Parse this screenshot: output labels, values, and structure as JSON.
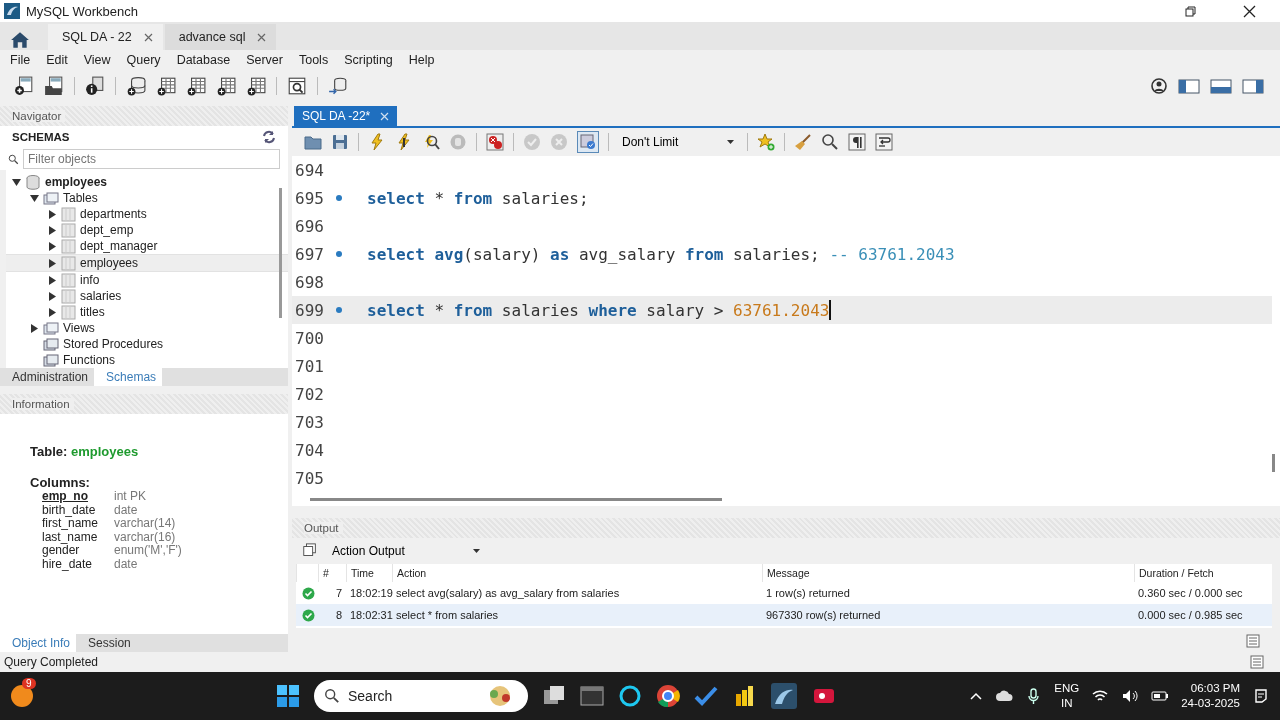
{
  "window": {
    "title": "MySQL Workbench"
  },
  "connection_tabs": [
    {
      "label": "SQL DA - 22",
      "selected": true
    },
    {
      "label": "advance sql",
      "selected": false
    }
  ],
  "menu": [
    "File",
    "Edit",
    "View",
    "Query",
    "Database",
    "Server",
    "Tools",
    "Scripting",
    "Help"
  ],
  "navigator": {
    "header": "Navigator",
    "schemas_title": "SCHEMAS",
    "filter_placeholder": "Filter objects",
    "tree": [
      {
        "label": "employees",
        "kind": "schema",
        "expanded": true,
        "selected": false,
        "children": [
          {
            "label": "Tables",
            "kind": "folder",
            "expanded": true,
            "selected": false,
            "children": [
              {
                "label": "departments",
                "kind": "table",
                "expanded": false,
                "selected": false
              },
              {
                "label": "dept_emp",
                "kind": "table",
                "expanded": false,
                "selected": false
              },
              {
                "label": "dept_manager",
                "kind": "table",
                "expanded": false,
                "selected": false
              },
              {
                "label": "employees",
                "kind": "table",
                "expanded": false,
                "selected": true
              },
              {
                "label": "info",
                "kind": "table",
                "expanded": false,
                "selected": false
              },
              {
                "label": "salaries",
                "kind": "table",
                "expanded": false,
                "selected": false
              },
              {
                "label": "titles",
                "kind": "table",
                "expanded": false,
                "selected": false
              }
            ]
          },
          {
            "label": "Views",
            "kind": "folder",
            "expanded": false,
            "selected": false
          },
          {
            "label": "Stored Procedures",
            "kind": "group",
            "selected": false
          },
          {
            "label": "Functions",
            "kind": "group",
            "selected": false
          }
        ]
      }
    ],
    "tabs": [
      {
        "label": "Administration",
        "selected": false
      },
      {
        "label": "Schemas",
        "selected": true
      }
    ]
  },
  "information": {
    "header": "Information",
    "table_label": "Table:",
    "table_name": "employees",
    "columns_label": "Columns:",
    "columns": [
      {
        "name": "emp_no",
        "type": "int PK",
        "primary": true
      },
      {
        "name": "birth_date",
        "type": "date",
        "primary": false
      },
      {
        "name": "first_name",
        "type": "varchar(14)",
        "primary": false
      },
      {
        "name": "last_name",
        "type": "varchar(16)",
        "primary": false
      },
      {
        "name": "gender",
        "type": "enum('M','F')",
        "primary": false
      },
      {
        "name": "hire_date",
        "type": "date",
        "primary": false
      }
    ],
    "tabs": [
      {
        "label": "Object Info",
        "selected": true
      },
      {
        "label": "Session",
        "selected": false
      }
    ]
  },
  "editor": {
    "tab": "SQL DA -22*",
    "limit": "Don't Limit",
    "autocommit": true,
    "lines": [
      {
        "number": "694",
        "statement": false,
        "current": false
      },
      {
        "number": "695",
        "statement": true,
        "current": false,
        "tokens": [
          {
            "kind": "keyword",
            "text": "select"
          },
          {
            "kind": "plain",
            "text": " * "
          },
          {
            "kind": "keyword",
            "text": "from"
          },
          {
            "kind": "plain",
            "text": " salaries;"
          }
        ]
      },
      {
        "number": "696",
        "statement": false,
        "current": false
      },
      {
        "number": "697",
        "statement": true,
        "current": false,
        "tokens": [
          {
            "kind": "keyword",
            "text": "select avg"
          },
          {
            "kind": "plain",
            "text": "(salary) "
          },
          {
            "kind": "keyword",
            "text": "as"
          },
          {
            "kind": "plain",
            "text": " avg_salary "
          },
          {
            "kind": "keyword",
            "text": "from"
          },
          {
            "kind": "plain",
            "text": " salaries; "
          },
          {
            "kind": "comment",
            "text": "-- 63761.2043"
          }
        ]
      },
      {
        "number": "698",
        "statement": false,
        "current": false
      },
      {
        "number": "699",
        "statement": true,
        "current": true,
        "tokens": [
          {
            "kind": "keyword",
            "text": "select"
          },
          {
            "kind": "plain",
            "text": " * "
          },
          {
            "kind": "keyword",
            "text": "from"
          },
          {
            "kind": "plain",
            "text": " salaries "
          },
          {
            "kind": "keyword",
            "text": "where"
          },
          {
            "kind": "plain",
            "text": " salary > "
          },
          {
            "kind": "number",
            "text": "63761.2043"
          }
        ]
      },
      {
        "number": "700",
        "statement": false,
        "current": false
      },
      {
        "number": "701",
        "statement": false,
        "current": false
      },
      {
        "number": "702",
        "statement": false,
        "current": false
      },
      {
        "number": "703",
        "statement": false,
        "current": false
      },
      {
        "number": "704",
        "statement": false,
        "current": false
      },
      {
        "number": "705",
        "statement": false,
        "current": false
      }
    ]
  },
  "output": {
    "header": "Output",
    "mode": "Action Output",
    "columns": [
      "#",
      "Time",
      "Action",
      "Message",
      "Duration / Fetch"
    ],
    "rows": [
      {
        "kind": "success",
        "number": "7",
        "time": "18:02:19",
        "action": "select avg(salary) as avg_salary from salaries",
        "message": "1 row(s) returned",
        "duration": "0.360 sec / 0.000 sec",
        "selected": false
      },
      {
        "kind": "success",
        "number": "8",
        "time": "18:02:31",
        "action": "select * from salaries",
        "message": "967330 row(s) returned",
        "duration": "0.000 sec / 0.985 sec",
        "selected": true
      }
    ]
  },
  "status_bar": {
    "text": "Query Completed"
  },
  "taskbar": {
    "notification_count": "9",
    "search_label": "Search",
    "language": "ENG",
    "region": "IN",
    "time": "06:03 PM",
    "date": "24-03-2025"
  }
}
